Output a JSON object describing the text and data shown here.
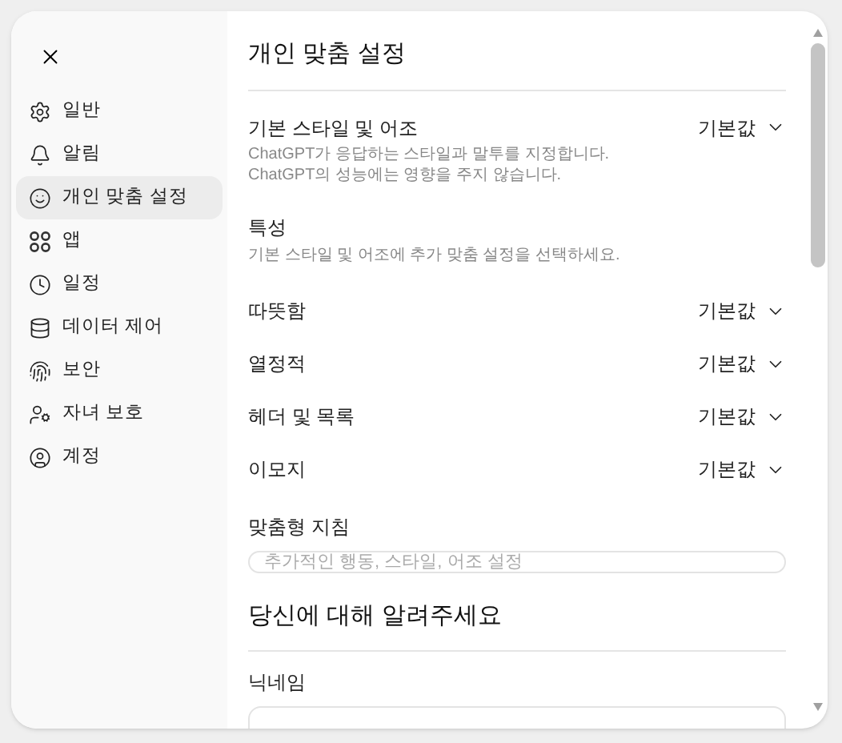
{
  "sidebar": {
    "items": [
      {
        "label": "일반",
        "selected": false
      },
      {
        "label": "알림",
        "selected": false
      },
      {
        "label": "개인 맞춤 설정",
        "selected": true
      },
      {
        "label": "앱",
        "selected": false
      },
      {
        "label": "일정",
        "selected": false
      },
      {
        "label": "데이터 제어",
        "selected": false
      },
      {
        "label": "보안",
        "selected": false
      },
      {
        "label": "자녀 보호",
        "selected": false
      },
      {
        "label": "계정",
        "selected": false
      }
    ]
  },
  "page_title": "개인 맞춤 설정",
  "base_style": {
    "label": "기본 스타일 및 어조",
    "description": "ChatGPT가 응답하는 스타일과 말투를 지정합니다. ChatGPT의 성능에는 영향을 주지 않습니다.",
    "value": "기본값"
  },
  "traits": {
    "label": "특성",
    "description": "기본 스타일 및 어조에 추가 맞춤 설정을 선택하세요.",
    "options": [
      {
        "label": "따뜻함",
        "value": "기본값"
      },
      {
        "label": "열정적",
        "value": "기본값"
      },
      {
        "label": "헤더 및 목록",
        "value": "기본값"
      },
      {
        "label": "이모지",
        "value": "기본값"
      }
    ]
  },
  "custom_instructions": {
    "label": "맞춤형 지침",
    "placeholder": "추가적인 행동, 스타일, 어조 설정"
  },
  "about_section": {
    "title": "당신에 대해 알려주세요"
  },
  "nickname": {
    "label": "닉네임"
  }
}
